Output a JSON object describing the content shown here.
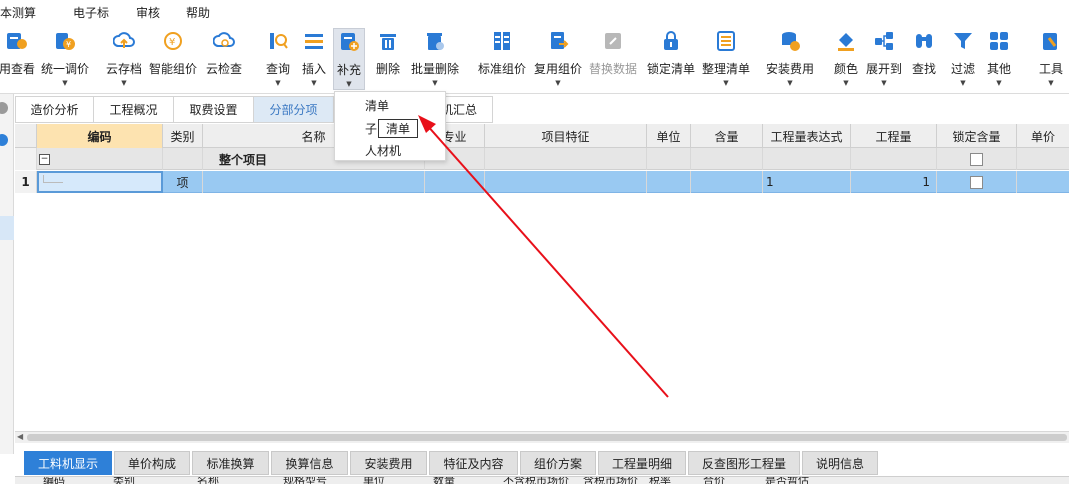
{
  "menu": [
    "本测算",
    "电子标",
    "审核",
    "帮助"
  ],
  "toolbar": [
    {
      "id": "view",
      "label": "用查看",
      "icon": "view-icon",
      "color": "#2a7ad5",
      "dropdown": false
    },
    {
      "id": "adjust",
      "label": "统一调价",
      "icon": "adjust-price-icon",
      "color": "#e8a020",
      "dropdown": true
    },
    {
      "id": "cloud-save",
      "label": "云存档",
      "icon": "cloud-upload-icon",
      "color": "#2a7ad5",
      "dropdown": true
    },
    {
      "id": "smart-price",
      "label": "智能组价",
      "icon": "smart-price-icon",
      "color": "#e8a020",
      "dropdown": false
    },
    {
      "id": "cloud-check",
      "label": "云检查",
      "icon": "cloud-check-icon",
      "color": "#2a7ad5",
      "dropdown": false
    },
    {
      "id": "query",
      "label": "查询",
      "icon": "query-icon",
      "color": "#2a7ad5",
      "dropdown": true
    },
    {
      "id": "insert",
      "label": "插入",
      "icon": "insert-icon",
      "color": "#2a7ad5",
      "dropdown": true
    },
    {
      "id": "supplement",
      "label": "补充",
      "icon": "supplement-icon",
      "color": "#2a7ad5",
      "dropdown": true
    },
    {
      "id": "delete",
      "label": "删除",
      "icon": "trash-icon",
      "color": "#2a7ad5",
      "dropdown": false
    },
    {
      "id": "batch-delete",
      "label": "批量删除",
      "icon": "batch-delete-icon",
      "color": "#2a7ad5",
      "dropdown": true
    },
    {
      "id": "std-price",
      "label": "标准组价",
      "icon": "standard-price-icon",
      "color": "#2a7ad5",
      "dropdown": false
    },
    {
      "id": "reuse-price",
      "label": "复用组价",
      "icon": "reuse-price-icon",
      "color": "#2a7ad5",
      "dropdown": true
    },
    {
      "id": "replace-data",
      "label": "替换数据",
      "icon": "replace-data-icon",
      "color": "#aaaaaa",
      "dropdown": false,
      "disabled": true
    },
    {
      "id": "lock-list",
      "label": "锁定清单",
      "icon": "lock-icon",
      "color": "#2a7ad5",
      "dropdown": false
    },
    {
      "id": "organize-list",
      "label": "整理清单",
      "icon": "organize-list-icon",
      "color": "#2a7ad5",
      "dropdown": true
    },
    {
      "id": "install-fee",
      "label": "安装费用",
      "icon": "install-fee-icon",
      "color": "#2a7ad5",
      "dropdown": true
    },
    {
      "id": "color",
      "label": "颜色",
      "icon": "color-bucket-icon",
      "color": "#2a7ad5",
      "dropdown": true
    },
    {
      "id": "expand",
      "label": "展开到",
      "icon": "expand-tree-icon",
      "color": "#2a7ad5",
      "dropdown": true
    },
    {
      "id": "find",
      "label": "查找",
      "icon": "binoculars-icon",
      "color": "#2a7ad5",
      "dropdown": false
    },
    {
      "id": "filter",
      "label": "过滤",
      "icon": "filter-icon",
      "color": "#2a7ad5",
      "dropdown": true
    },
    {
      "id": "other",
      "label": "其他",
      "icon": "grid-apps-icon",
      "color": "#2a7ad5",
      "dropdown": true
    },
    {
      "id": "tools",
      "label": "工具",
      "icon": "tools-icon",
      "color": "#2a7ad5",
      "dropdown": true
    }
  ],
  "tabs": [
    "造价分析",
    "工程概况",
    "取费设置",
    "分部分项",
    "",
    "材机汇总"
  ],
  "selected_tab": "分部分项",
  "grid": {
    "headers": [
      "编码",
      "类别",
      "名称",
      "专业",
      "项目特征",
      "单位",
      "含量",
      "工程量表达式",
      "工程量",
      "锁定含量",
      "单价"
    ],
    "root_row": {
      "expander": "−",
      "name": "整个项目"
    },
    "rows": [
      {
        "num": "1",
        "code": "",
        "type": "项",
        "name": "",
        "expr": "1",
        "qty": "1"
      }
    ]
  },
  "dropdown": {
    "items": [
      "清单",
      "子",
      "人材机"
    ],
    "tooltip": "清单"
  },
  "bottom_tabs": [
    "工料机显示",
    "单价构成",
    "标准换算",
    "换算信息",
    "安装费用",
    "特征及内容",
    "组价方案",
    "工程量明细",
    "反查图形工程量",
    "说明信息"
  ],
  "bottom_header": [
    "编码",
    "类别",
    "名称",
    "规格型号",
    "单位",
    "数量",
    "不含税市场价",
    "含税市场价",
    "税率",
    "合价",
    "是否暂估"
  ],
  "colors": {
    "accent": "#2e80d8",
    "row_selected": "#99c9f2",
    "header_code": "#fde3b0",
    "arrow": "#e8101a"
  }
}
